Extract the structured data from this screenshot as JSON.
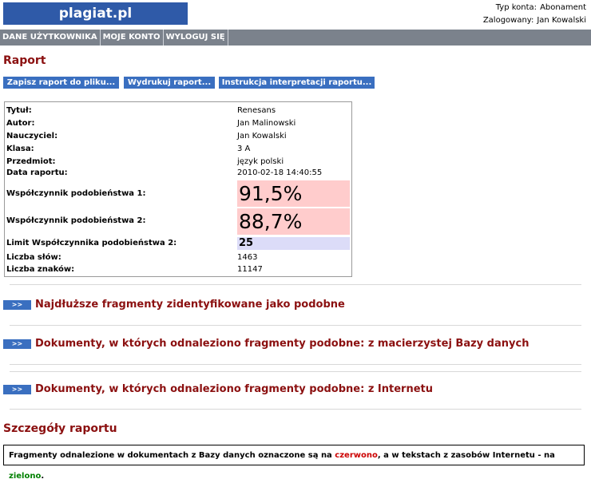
{
  "logo": "plagiat.pl",
  "account": {
    "type_label": "Typ konta:",
    "type_value": "Abonament",
    "user_label": "Zalogowany:",
    "user_value": "Jan Kowalski"
  },
  "nav": [
    "DANE UŻYTKOWNIKA",
    "MOJE KONTO",
    "WYLOGUJ SIĘ"
  ],
  "page_title": "Raport",
  "buttons": [
    "Zapisz raport do pliku...",
    "Wydrukuj raport...",
    "Instrukcja interpretacji raportu..."
  ],
  "report": {
    "fields": [
      {
        "label": "Tytuł:",
        "value": "Renesans"
      },
      {
        "label": "Autor:",
        "value": "Jan Malinowski"
      },
      {
        "label": "Nauczyciel:",
        "value": "Jan Kowalski"
      },
      {
        "label": "Klasa:",
        "value": "3 A"
      },
      {
        "label": "Przedmiot:",
        "value": "język polski"
      },
      {
        "label": "Data raportu:",
        "value": "2010-02-18 14:40:55"
      }
    ],
    "coef1": {
      "label": "Współczynnik podobieństwa 1:",
      "value": "91,5%"
    },
    "coef2": {
      "label": "Współczynnik podobieństwa 2:",
      "value": "88,7%"
    },
    "limit": {
      "label": "Limit Współczynnika podobieństwa 2:",
      "value": "25"
    },
    "words": {
      "label": "Liczba słów:",
      "value": "1463"
    },
    "chars": {
      "label": "Liczba znaków:",
      "value": "11147"
    }
  },
  "sections": {
    "arrow": ">>",
    "longest": "Najdłuższe fragmenty zidentyfikowane jako podobne",
    "home_db": "Dokumenty, w których odnaleziono fragmenty podobne: z macierzystej Bazy danych",
    "internet": "Dokumenty, w których odnaleziono fragmenty podobne: z Internetu"
  },
  "details_title": "Szczegóły raportu",
  "legend": {
    "part1": "Fragmenty odnalezione w dokumentach z Bazy danych oznaczone są na ",
    "red": "czerwono",
    "part2": ", a w tekstach z zasobów Internetu - na ",
    "green": "zielono",
    "part3": "."
  },
  "colors": {
    "accent_blue": "#3a6fc0",
    "title_red": "#8b1010",
    "nav_gray": "#7b828c",
    "highlight_red": "#ffcccc",
    "highlight_blue": "#dcdcf8"
  }
}
